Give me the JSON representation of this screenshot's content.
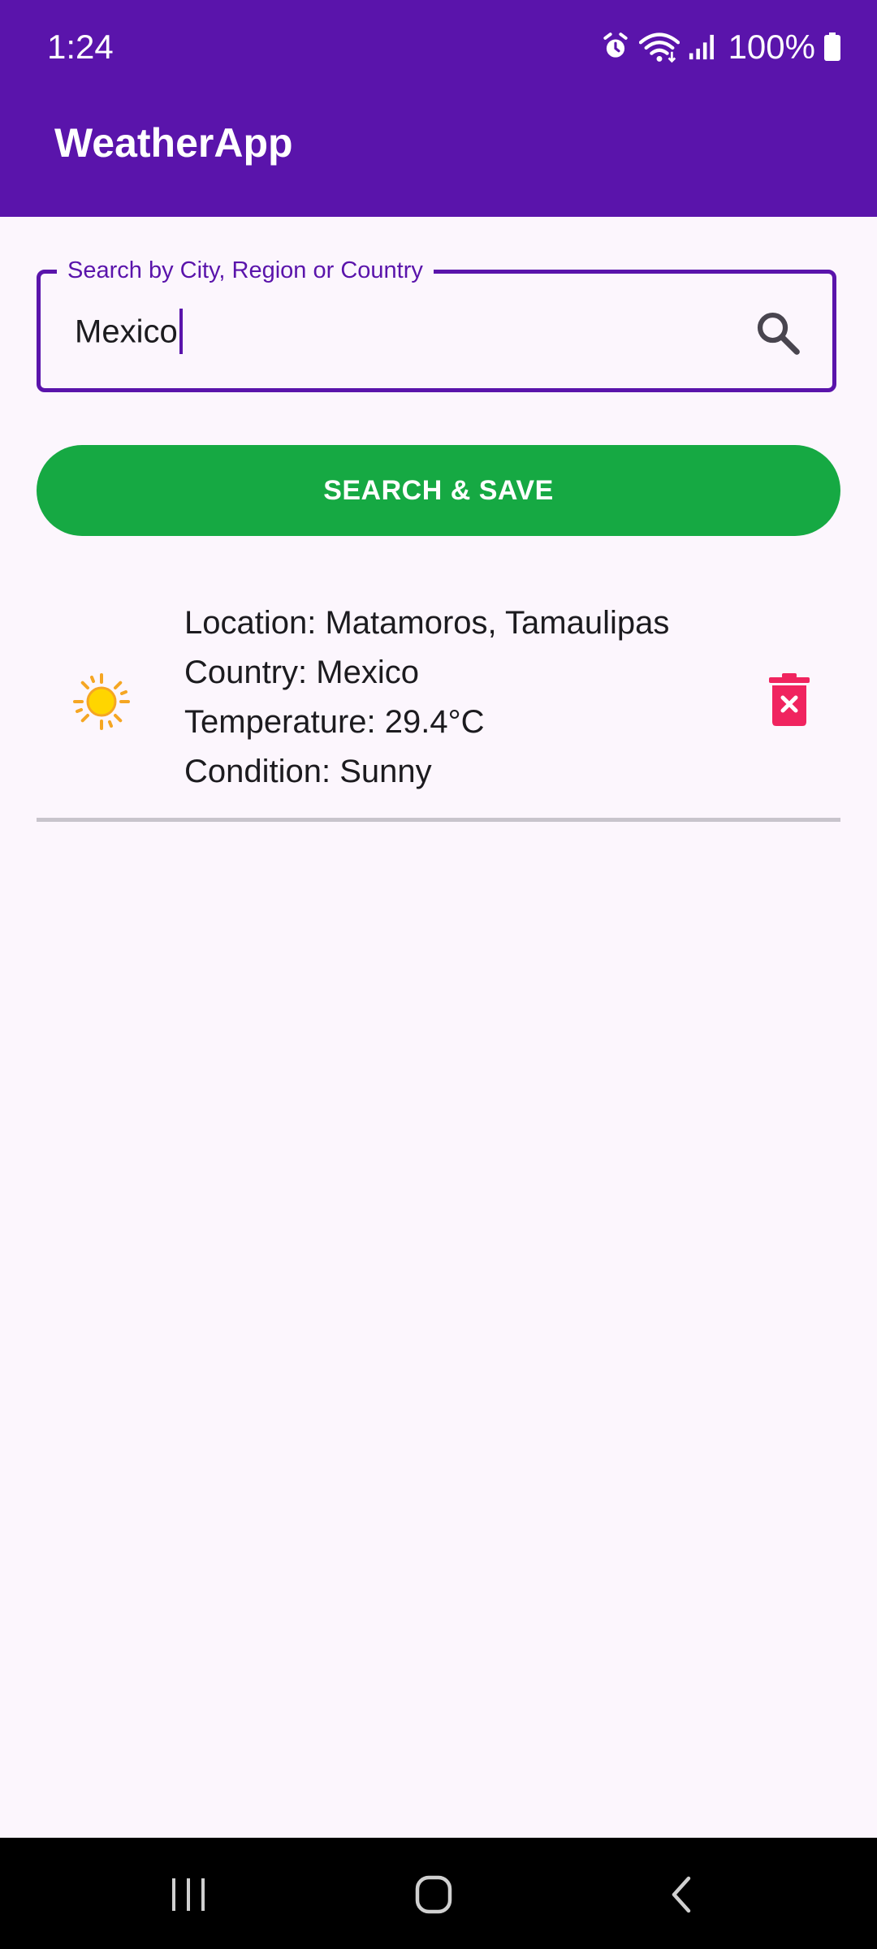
{
  "status_bar": {
    "time": "1:24",
    "battery": "100%",
    "icons": [
      "alarm-icon",
      "wifi-icon",
      "signal-icon",
      "battery-icon"
    ]
  },
  "app_bar": {
    "title": "WeatherApp"
  },
  "search": {
    "label": "Search by City, Region or Country",
    "value": "Mexico",
    "icon": "search-icon"
  },
  "save_button": {
    "label": "SEARCH & SAVE"
  },
  "weather_list": [
    {
      "icon": "sun-icon",
      "location": "Location: Matamoros, Tamaulipas",
      "country": "Country: Mexico",
      "temperature": "Temperature: 29.4°C",
      "condition": "Condition: Sunny",
      "delete_icon": "delete-icon"
    }
  ],
  "nav_bar": {
    "buttons": [
      "recents-icon",
      "home-icon",
      "back-icon"
    ]
  },
  "colors": {
    "primary": "#5a14ab",
    "button": "#16a943",
    "delete": "#f0245f",
    "background": "#fcf6fd"
  }
}
